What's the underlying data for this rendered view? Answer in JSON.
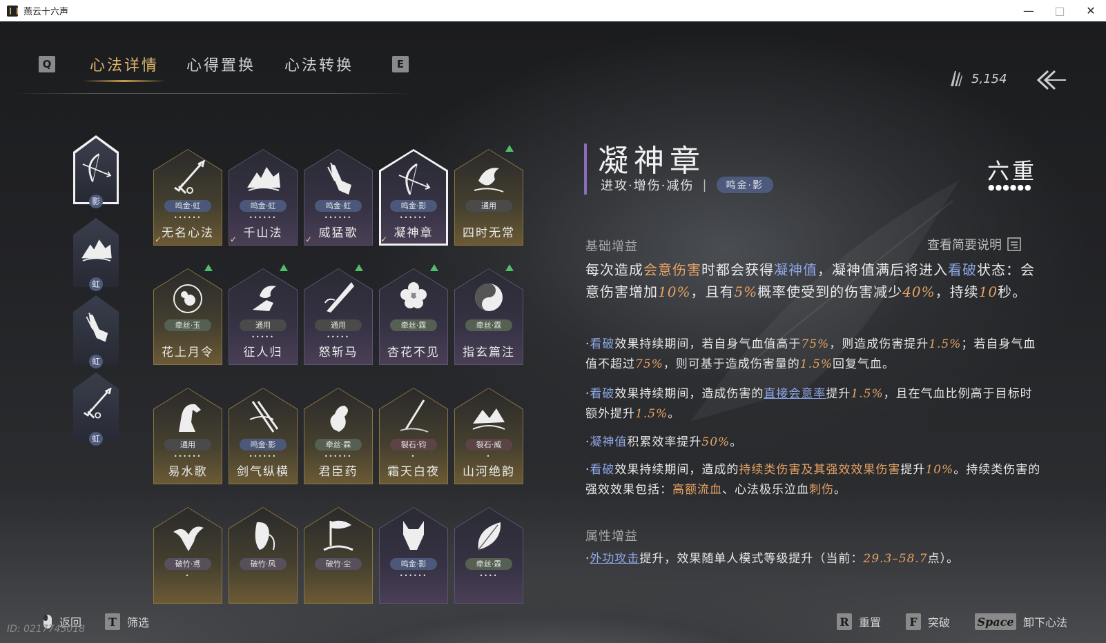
{
  "window": {
    "title": "燕云十六声",
    "minimize": "—",
    "maximize": "□",
    "close": "✕"
  },
  "tabs": {
    "key_left": "Q",
    "key_right": "E",
    "items": [
      {
        "label": "心法详情"
      },
      {
        "label": "心得置换"
      },
      {
        "label": "心法转换"
      }
    ]
  },
  "currency": {
    "icon": "feather-icon",
    "value": "5,154"
  },
  "left_slots": [
    {
      "tag": "影",
      "icon": "bow-arrow-icon"
    },
    {
      "tag": "虹",
      "icon": "mountain-icon"
    },
    {
      "tag": "虹",
      "icon": "hand-icon"
    },
    {
      "tag": "虹",
      "icon": "sword-icon"
    }
  ],
  "cards": [
    {
      "name": "无名心法",
      "tag": "鸣金·虹",
      "dots": "••••••",
      "theme": "gold",
      "check": true,
      "up": false,
      "icon": "sword-icon"
    },
    {
      "name": "千山法",
      "tag": "鸣金·虹",
      "dots": "••••••",
      "theme": "purple",
      "check": true,
      "up": false,
      "icon": "mountain-icon"
    },
    {
      "name": "威猛歌",
      "tag": "鸣金·虹",
      "dots": "••••••",
      "theme": "purple",
      "check": true,
      "up": false,
      "icon": "hand-icon"
    },
    {
      "name": "凝神章",
      "tag": "鸣金·影",
      "dots": "••••••",
      "theme": "purple",
      "check": true,
      "up": false,
      "icon": "bow-arrow-icon",
      "selected": true
    },
    {
      "name": "四时无常",
      "tag": "通用",
      "dots": "",
      "theme": "gold",
      "check": false,
      "up": true,
      "icon": "bird-icon"
    },
    {
      "name": "花上月令",
      "tag": "牵丝·玉",
      "dots": "",
      "theme": "gold",
      "check": false,
      "up": true,
      "icon": "flower-moon-icon"
    },
    {
      "name": "征人归",
      "tag": "通用",
      "dots": "•••••",
      "theme": "purple",
      "check": false,
      "up": true,
      "icon": "bird-hand-icon"
    },
    {
      "name": "怒斩马",
      "tag": "通用",
      "dots": "•••••",
      "theme": "purple",
      "check": false,
      "up": true,
      "icon": "blade-icon"
    },
    {
      "name": "杏花不见",
      "tag": "牵丝·霖",
      "dots": "",
      "theme": "purple",
      "check": false,
      "up": true,
      "icon": "flower-icon"
    },
    {
      "name": "指玄篇注",
      "tag": "牵丝·霖",
      "dots": "",
      "theme": "purple",
      "check": false,
      "up": true,
      "icon": "yin-yang-icon"
    },
    {
      "name": "易水歌",
      "tag": "通用",
      "dots": "••••••",
      "theme": "gold",
      "check": false,
      "up": false,
      "icon": "horse-icon"
    },
    {
      "name": "剑气纵横",
      "tag": "鸣金·影",
      "dots": "••••••",
      "theme": "gold",
      "check": false,
      "up": false,
      "icon": "twin-sword-icon"
    },
    {
      "name": "君臣药",
      "tag": "牵丝·霖",
      "dots": "••••••",
      "theme": "gold",
      "check": false,
      "up": false,
      "icon": "gourd-icon"
    },
    {
      "name": "霜天白夜",
      "tag": "裂石·钧",
      "dots": "•",
      "theme": "gold",
      "check": false,
      "up": false,
      "icon": "spear-icon"
    },
    {
      "name": "山河绝韵",
      "tag": "裂石·威",
      "dots": "•",
      "theme": "gold",
      "check": false,
      "up": false,
      "icon": "landscape-icon"
    },
    {
      "name": "",
      "tag": "破竹·鸢",
      "dots": "•",
      "theme": "gold",
      "check": false,
      "up": false,
      "icon": "eagle-icon"
    },
    {
      "name": "",
      "tag": "破竹·风",
      "dots": "",
      "theme": "gold",
      "check": false,
      "up": false,
      "icon": "mask-icon"
    },
    {
      "name": "",
      "tag": "破竹·尘",
      "dots": "",
      "theme": "gold",
      "check": false,
      "up": false,
      "icon": "flag-icon"
    },
    {
      "name": "",
      "tag": "鸣金·影",
      "dots": "••••••",
      "theme": "purple",
      "check": false,
      "up": false,
      "icon": "wolf-icon"
    },
    {
      "name": "",
      "tag": "牵丝·霖",
      "dots": "••••",
      "theme": "purple",
      "check": false,
      "up": false,
      "icon": "leaf-icon"
    }
  ],
  "detail": {
    "title": "凝神章",
    "sub": "进攻·增伤·减伤",
    "sep": "|",
    "pill": "鸣金·影",
    "rank": "六重",
    "rank_dots": "●●●●●●",
    "sec_base": "基础增益",
    "help": "查看简要说明",
    "sec_attr": "属性增益",
    "p1": {
      "a": "每次造成",
      "b": "会意伤害",
      "c": "时都会获得",
      "d": "凝神值",
      "e": "，凝神值满后将进入",
      "f": "看破",
      "g": "状态：会意伤害增加",
      "h": "10%",
      "i": "，且有",
      "j": "5%",
      "k": "概率使受到的伤害减少",
      "l": "40%",
      "m": "，持续",
      "n": "10",
      "o": "秒。"
    },
    "p2": {
      "a": "·",
      "b": "看破",
      "c": "效果持续期间，若自身气血值高于",
      "d": "75%",
      "e": "，则造成伤害提升",
      "f": "1.5%",
      "g": "；若自身气血值不超过",
      "h": "75%",
      "i": "，则可基于造成伤害量的",
      "j": "1.5%",
      "k": "回复气血。"
    },
    "p3": {
      "a": "·",
      "b": "看破",
      "c": "效果持续期间，造成伤害的",
      "d": "直接会意率",
      "e": "提升",
      "f": "1.5%",
      "g": "，且在气血比例高于目标时额外提升",
      "h": "1.5%",
      "i": "。"
    },
    "p4": {
      "a": "·",
      "b": "凝神值",
      "c": "积累效率提升",
      "d": "50%",
      "e": "。"
    },
    "p5": {
      "a": "·",
      "b": "看破",
      "c": "效果持续期间，造成的",
      "d": "持续类伤害及其强效效果伤害",
      "e": "提升",
      "f": "10%",
      "g": "。持续类伤害的强效效果包括：",
      "h": "高额流血",
      "i": "、心法极乐泣血",
      "j": "刺伤",
      "k": "。"
    },
    "p6": {
      "a": "·",
      "b": "外功攻击",
      "c": "提升，效果随单人模式等级提升（当前：",
      "d": "29.3–58.7",
      "e": "点）。"
    }
  },
  "bottom": {
    "back": "返回",
    "filter_key": "T",
    "filter": "筛选",
    "reset_key": "R",
    "reset": "重置",
    "break_key": "F",
    "break": "突破",
    "space_key": "Space",
    "unload": "卸下心法",
    "id": "ID: 0217745018"
  }
}
